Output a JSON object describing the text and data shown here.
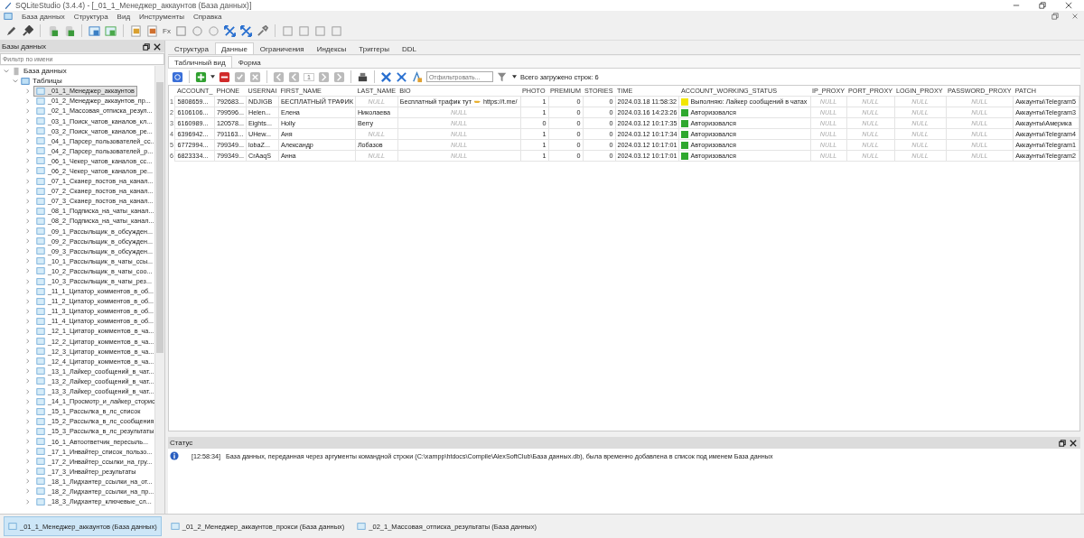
{
  "window": {
    "title": "SQLiteStudio (3.4.4) - [_01_1_Менеджер_аккаунтов (База данных)]"
  },
  "menu": [
    "База данных",
    "Структура",
    "Вид",
    "Инструменты",
    "Справка"
  ],
  "toolbar_label": "Fx",
  "db_panel": {
    "title": "Базы данных",
    "filter_placeholder": "Фильтр по имени",
    "tree": [
      {
        "label": "База данных",
        "expanded": true,
        "children": [
          {
            "label": "Таблицы",
            "expanded": true,
            "children": [
              {
                "label": "_01_1_Менеджер_аккаунтов",
                "selected": true,
                "expanded": false
              },
              {
                "label": "_01_2_Менеджер_аккаунтов_пр...",
                "selected": false,
                "expanded": false
              },
              {
                "label": "_02_1_Массовая_отписка_резул...",
                "selected": false,
                "expanded": false
              },
              {
                "label": "_03_1_Поиск_чатов_каналов_кл...",
                "selected": false,
                "expanded": false
              },
              {
                "label": "_03_2_Поиск_чатов_каналов_ре...",
                "selected": false,
                "expanded": false
              },
              {
                "label": "_04_1_Парсер_пользователей_сс...",
                "selected": false,
                "expanded": false
              },
              {
                "label": "_04_2_Парсер_пользователей_р...",
                "selected": false,
                "expanded": false
              },
              {
                "label": "_06_1_Чекер_чатов_каналов_сс...",
                "selected": false,
                "expanded": false
              },
              {
                "label": "_06_2_Чекер_чатов_каналов_ре...",
                "selected": false,
                "expanded": false
              },
              {
                "label": "_07_1_Сканер_постов_на_канал...",
                "selected": false,
                "expanded": false
              },
              {
                "label": "_07_2_Сканер_постов_на_канал...",
                "selected": false,
                "expanded": false
              },
              {
                "label": "_07_3_Сканер_постов_на_канал...",
                "selected": false,
                "expanded": false
              },
              {
                "label": "_08_1_Подписка_на_чаты_канал...",
                "selected": false,
                "expanded": false
              },
              {
                "label": "_08_2_Подписка_на_чаты_канал...",
                "selected": false,
                "expanded": false
              },
              {
                "label": "_09_1_Рассыльщик_в_обсужден...",
                "selected": false,
                "expanded": false
              },
              {
                "label": "_09_2_Рассыльщик_в_обсужден...",
                "selected": false,
                "expanded": false
              },
              {
                "label": "_09_3_Рассыльщик_в_обсужден...",
                "selected": false,
                "expanded": false
              },
              {
                "label": "_10_1_Рассыльщик_в_чаты_ссы...",
                "selected": false,
                "expanded": false
              },
              {
                "label": "_10_2_Рассыльщик_в_чаты_соо...",
                "selected": false,
                "expanded": false
              },
              {
                "label": "_10_3_Рассыльщик_в_чаты_рез...",
                "selected": false,
                "expanded": false
              },
              {
                "label": "_11_1_Цитатор_комментов_в_об...",
                "selected": false,
                "expanded": false
              },
              {
                "label": "_11_2_Цитатор_комментов_в_об...",
                "selected": false,
                "expanded": false
              },
              {
                "label": "_11_3_Цитатор_комментов_в_об...",
                "selected": false,
                "expanded": false
              },
              {
                "label": "_11_4_Цитатор_комментов_в_об...",
                "selected": false,
                "expanded": false
              },
              {
                "label": "_12_1_Цитатор_комментов_в_ча...",
                "selected": false,
                "expanded": false
              },
              {
                "label": "_12_2_Цитатор_комментов_в_ча...",
                "selected": false,
                "expanded": false
              },
              {
                "label": "_12_3_Цитатор_комментов_в_ча...",
                "selected": false,
                "expanded": false
              },
              {
                "label": "_12_4_Цитатор_комментов_в_ча...",
                "selected": false,
                "expanded": false
              },
              {
                "label": "_13_1_Лайкер_сообщений_в_чат...",
                "selected": false,
                "expanded": false
              },
              {
                "label": "_13_2_Лайкер_сообщений_в_чат...",
                "selected": false,
                "expanded": false
              },
              {
                "label": "_13_3_Лайкер_сообщений_в_чат...",
                "selected": false,
                "expanded": false
              },
              {
                "label": "_14_1_Просмотр_и_лайкер_сторис",
                "selected": false,
                "expanded": false
              },
              {
                "label": "_15_1_Рассылка_в_лс_список",
                "selected": false,
                "expanded": false
              },
              {
                "label": "_15_2_Рассылка_в_лс_сообщения",
                "selected": false,
                "expanded": false
              },
              {
                "label": "_15_3_Рассылка_в_лс_результаты",
                "selected": false,
                "expanded": false
              },
              {
                "label": "_16_1_Автоответчик_пересыль...",
                "selected": false,
                "expanded": false
              },
              {
                "label": "_17_1_Инвайтер_список_пользо...",
                "selected": false,
                "expanded": false
              },
              {
                "label": "_17_2_Инвайтер_ссылки_на_гру...",
                "selected": false,
                "expanded": false
              },
              {
                "label": "_17_3_Инвайтер_результаты",
                "selected": false,
                "expanded": false
              },
              {
                "label": "_18_1_Лидхантер_ссылки_на_от...",
                "selected": false,
                "expanded": false
              },
              {
                "label": "_18_2_Лидхантер_ссылки_на_пр...",
                "selected": false,
                "expanded": false
              },
              {
                "label": "_18_3_Лидхантер_ключевые_сл...",
                "selected": false,
                "expanded": false
              }
            ]
          }
        ]
      }
    ]
  },
  "tabs": [
    {
      "label": "Структура",
      "selected": false
    },
    {
      "label": "Данные",
      "selected": true
    },
    {
      "label": "Ограничения",
      "selected": false
    },
    {
      "label": "Индексы",
      "selected": false
    },
    {
      "label": "Триггеры",
      "selected": false
    },
    {
      "label": "DDL",
      "selected": false
    }
  ],
  "subtabs": [
    {
      "label": "Табличный вид",
      "selected": true
    },
    {
      "label": "Форма",
      "selected": false
    }
  ],
  "data_toolbar": {
    "page": "1",
    "filter_placeholder": "Отфильтровать...",
    "row_count": "Всего загружено строк: 6"
  },
  "table": {
    "columns": [
      "ACCOUNT_",
      "PHONE",
      "USERNAI",
      "FIRST_NAME",
      "LAST_NAME",
      "BIO",
      "PHOTO",
      "PREMIUM",
      "STORIES",
      "TIME",
      "ACCOUNT_WORKING_STATUS",
      "IP_PROXY",
      "PORT_PROXY",
      "LOGIN_PROXY",
      "PASSWORD_PROXY",
      "PATCH"
    ],
    "rows": [
      {
        "number": "1",
        "cells": [
          {
            "kind": "text",
            "text": "5808659..."
          },
          {
            "kind": "text",
            "text": "792683..."
          },
          {
            "kind": "text",
            "text": "NDJIGB"
          },
          {
            "kind": "text",
            "text": "БЕСПЛАТНЫЙ ТРАФИК"
          },
          {
            "kind": "null",
            "text": "NULL"
          },
          {
            "kind": "bio",
            "text": "Бесплатный трафик тут",
            "link": "https://t.me/"
          },
          {
            "kind": "number",
            "text": "1"
          },
          {
            "kind": "number",
            "text": "0"
          },
          {
            "kind": "number",
            "text": "0"
          },
          {
            "kind": "text",
            "text": "2024.03.18 11:58:32"
          },
          {
            "kind": "status",
            "text": "Выполняю: Лайкер сообщений в чатах",
            "color": "#f2e600"
          },
          {
            "kind": "null",
            "text": "NULL"
          },
          {
            "kind": "null",
            "text": "NULL"
          },
          {
            "kind": "null",
            "text": "NULL"
          },
          {
            "kind": "null",
            "text": "NULL"
          },
          {
            "kind": "text",
            "text": "Аккаунты\\Telegram5"
          }
        ]
      },
      {
        "number": "2",
        "cells": [
          {
            "kind": "text",
            "text": "6106106..."
          },
          {
            "kind": "text",
            "text": "799596..."
          },
          {
            "kind": "text",
            "text": "Helen..."
          },
          {
            "kind": "text",
            "text": "Елена"
          },
          {
            "kind": "text",
            "text": "Николаева"
          },
          {
            "kind": "null",
            "text": "NULL"
          },
          {
            "kind": "number",
            "text": "1"
          },
          {
            "kind": "number",
            "text": "0"
          },
          {
            "kind": "number",
            "text": "0"
          },
          {
            "kind": "text",
            "text": "2024.03.16 14:23:26"
          },
          {
            "kind": "status",
            "text": "Авторизовался",
            "color": "#2fa82f"
          },
          {
            "kind": "null",
            "text": "NULL"
          },
          {
            "kind": "null",
            "text": "NULL"
          },
          {
            "kind": "null",
            "text": "NULL"
          },
          {
            "kind": "null",
            "text": "NULL"
          },
          {
            "kind": "text",
            "text": "Аккаунты\\Telegram3"
          }
        ]
      },
      {
        "number": "3",
        "cells": [
          {
            "kind": "text",
            "text": "6160989..."
          },
          {
            "kind": "text",
            "text": "120578..."
          },
          {
            "kind": "text",
            "text": "Eights..."
          },
          {
            "kind": "text",
            "text": "Holly"
          },
          {
            "kind": "text",
            "text": "Berry"
          },
          {
            "kind": "null",
            "text": "NULL"
          },
          {
            "kind": "number",
            "text": "0"
          },
          {
            "kind": "number",
            "text": "0"
          },
          {
            "kind": "number",
            "text": "0"
          },
          {
            "kind": "text",
            "text": "2024.03.12 10:17:35"
          },
          {
            "kind": "status",
            "text": "Авторизовался",
            "color": "#2fa82f"
          },
          {
            "kind": "null",
            "text": "NULL"
          },
          {
            "kind": "null",
            "text": "NULL"
          },
          {
            "kind": "null",
            "text": "NULL"
          },
          {
            "kind": "null",
            "text": "NULL"
          },
          {
            "kind": "text",
            "text": "Аккаунты\\Америка"
          }
        ]
      },
      {
        "number": "4",
        "cells": [
          {
            "kind": "text",
            "text": "6396942..."
          },
          {
            "kind": "text",
            "text": "791163..."
          },
          {
            "kind": "text",
            "text": "UHew..."
          },
          {
            "kind": "text",
            "text": "Аня"
          },
          {
            "kind": "null",
            "text": "NULL"
          },
          {
            "kind": "null",
            "text": "NULL"
          },
          {
            "kind": "number",
            "text": "1"
          },
          {
            "kind": "number",
            "text": "0"
          },
          {
            "kind": "number",
            "text": "0"
          },
          {
            "kind": "text",
            "text": "2024.03.12 10:17:34"
          },
          {
            "kind": "status",
            "text": "Авторизовался",
            "color": "#2fa82f"
          },
          {
            "kind": "null",
            "text": "NULL"
          },
          {
            "kind": "null",
            "text": "NULL"
          },
          {
            "kind": "null",
            "text": "NULL"
          },
          {
            "kind": "null",
            "text": "NULL"
          },
          {
            "kind": "text",
            "text": "Аккаунты\\Telegram4"
          }
        ]
      },
      {
        "number": "5",
        "cells": [
          {
            "kind": "text",
            "text": "6772994..."
          },
          {
            "kind": "text",
            "text": "799349..."
          },
          {
            "kind": "text",
            "text": "lobaZ..."
          },
          {
            "kind": "text",
            "text": "Александр"
          },
          {
            "kind": "text",
            "text": "Лобазов"
          },
          {
            "kind": "null",
            "text": "NULL"
          },
          {
            "kind": "number",
            "text": "1"
          },
          {
            "kind": "number",
            "text": "0"
          },
          {
            "kind": "number",
            "text": "0"
          },
          {
            "kind": "text",
            "text": "2024.03.12 10:17:01"
          },
          {
            "kind": "status",
            "text": "Авторизовался",
            "color": "#2fa82f"
          },
          {
            "kind": "null",
            "text": "NULL"
          },
          {
            "kind": "null",
            "text": "NULL"
          },
          {
            "kind": "null",
            "text": "NULL"
          },
          {
            "kind": "null",
            "text": "NULL"
          },
          {
            "kind": "text",
            "text": "Аккаунты\\Telegram1"
          }
        ]
      },
      {
        "number": "6",
        "cells": [
          {
            "kind": "text",
            "text": "6823334..."
          },
          {
            "kind": "text",
            "text": "799349..."
          },
          {
            "kind": "text",
            "text": "CrAaqS"
          },
          {
            "kind": "text",
            "text": "Анна"
          },
          {
            "kind": "null",
            "text": "NULL"
          },
          {
            "kind": "null",
            "text": "NULL"
          },
          {
            "kind": "number",
            "text": "1"
          },
          {
            "kind": "number",
            "text": "0"
          },
          {
            "kind": "number",
            "text": "0"
          },
          {
            "kind": "text",
            "text": "2024.03.12 10:17:01"
          },
          {
            "kind": "status",
            "text": "Авторизовался",
            "color": "#2fa82f"
          },
          {
            "kind": "null",
            "text": "NULL"
          },
          {
            "kind": "null",
            "text": "NULL"
          },
          {
            "kind": "null",
            "text": "NULL"
          },
          {
            "kind": "null",
            "text": "NULL"
          },
          {
            "kind": "text",
            "text": "Аккаунты\\Telegram2"
          }
        ]
      }
    ]
  },
  "status_panel": {
    "title": "Статус",
    "messages": [
      {
        "time": "[12:58:34]",
        "text": "База данных, переданная через аргументы командной строки (C:\\xampp\\htdocs\\Compile\\AlexSoftClub\\База данных.db), была временно добавлена в список под именем База данных"
      }
    ]
  },
  "taskbar": [
    {
      "label": "_01_1_Менеджер_аккаунтов (База данных)",
      "selected": true
    },
    {
      "label": "_01_2_Менеджер_аккаунтов_прокси (База данных)",
      "selected": false
    },
    {
      "label": "_02_1_Массовая_отписка_результаты (База данных)",
      "selected": false
    }
  ]
}
